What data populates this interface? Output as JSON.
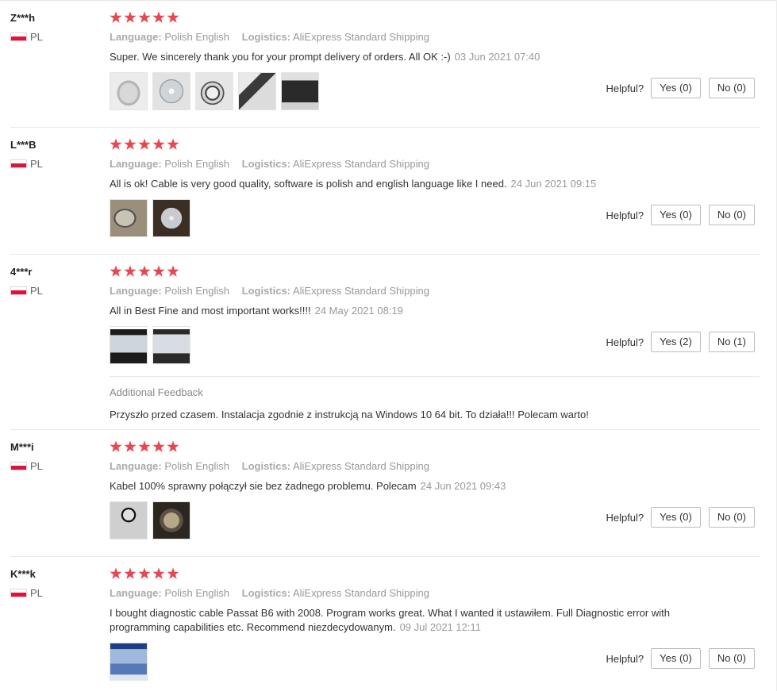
{
  "helpful_label": "Helpful?",
  "language_key": "Language:",
  "logistics_key": "Logistics:",
  "colors": {
    "star": "#e7474f",
    "flag_red": "#dc143c"
  },
  "reviews": [
    {
      "user": "Z***h",
      "country": "PL",
      "rating": 5,
      "language": "Polish English",
      "logistics": "AliExpress Standard Shipping",
      "text": "Super. We sincerely thank you for your prompt delivery of orders. All OK :-)",
      "date": "03 Jun 2021 07:40",
      "yes": "Yes (0)",
      "no": "No (0)"
    },
    {
      "user": "L***B",
      "country": "PL",
      "rating": 5,
      "language": "Polish English",
      "logistics": "AliExpress Standard Shipping",
      "text": "All is ok! Cable is very good quality, software is polish and english language like I need.",
      "date": "24 Jun 2021 09:15",
      "yes": "Yes (0)",
      "no": "No (0)"
    },
    {
      "user": "4***r",
      "country": "PL",
      "rating": 5,
      "language": "Polish English",
      "logistics": "AliExpress Standard Shipping",
      "text": "All in Best Fine and most important works!!!!",
      "date": "24 May 2021 08:19",
      "yes": "Yes (2)",
      "no": "No (1)",
      "additional_title": "Additional Feedback",
      "additional_text": "Przyszło przed czasem. Instalacja zgodnie z instrukcją na Windows 10 64 bit. To działa!!! Polecam warto!"
    },
    {
      "user": "M***i",
      "country": "PL",
      "rating": 5,
      "language": "Polish English",
      "logistics": "AliExpress Standard Shipping",
      "text": "Kabel 100% sprawny połączył sie bez żadnego problemu. Polecam",
      "date": "24 Jun 2021 09:43",
      "yes": "Yes (0)",
      "no": "No (0)"
    },
    {
      "user": "K***k",
      "country": "PL",
      "rating": 5,
      "language": "Polish English",
      "logistics": "AliExpress Standard Shipping",
      "text": "I bought diagnostic cable Passat B6 with 2008. Program works great. What I wanted it ustawiłem. Full Diagnostic error with programming capabilities etc. Recommend niezdecydowanym.",
      "date": "09 Jul 2021 12:11",
      "yes": "Yes (0)",
      "no": "No (0)"
    }
  ]
}
